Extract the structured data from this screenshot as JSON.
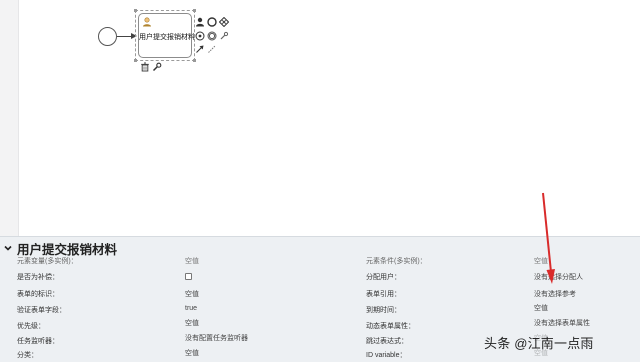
{
  "diagram": {
    "task_label": "用户提交报销材料"
  },
  "panel": {
    "title": "用户提交报销材料",
    "rows": [
      {
        "left_label": "元素变量(多实例)：",
        "left_value": "空值",
        "right_label": "元素条件(多实例)：",
        "right_value": "空值"
      },
      {
        "left_label": "是否为补偿：",
        "left_value": "",
        "right_label": "分配用户：",
        "right_value": "没有选择分配人"
      },
      {
        "left_label": "表单的标识：",
        "left_value": "空值",
        "right_label": "表单引用：",
        "right_value": "没有选择参考"
      },
      {
        "left_label": "验证表单字段：",
        "left_value": "true",
        "right_label": "到期时间：",
        "right_value": "空值"
      },
      {
        "left_label": "优先级：",
        "left_value": "空值",
        "right_label": "动态表单属性：",
        "right_value": "没有选择表单属性"
      },
      {
        "left_label": "任务监听器：",
        "left_value": "没有配置任务监听器",
        "right_label": "跳过表达式：",
        "right_value": "空值"
      },
      {
        "left_label": "分类：",
        "left_value": "空值",
        "right_label": "ID variable：",
        "right_value": "空值"
      }
    ]
  },
  "colors": {
    "annotation_arrow": "#d92b2b",
    "panel_bg": "#edf0f3"
  },
  "watermark": "头条 @江南一点雨"
}
